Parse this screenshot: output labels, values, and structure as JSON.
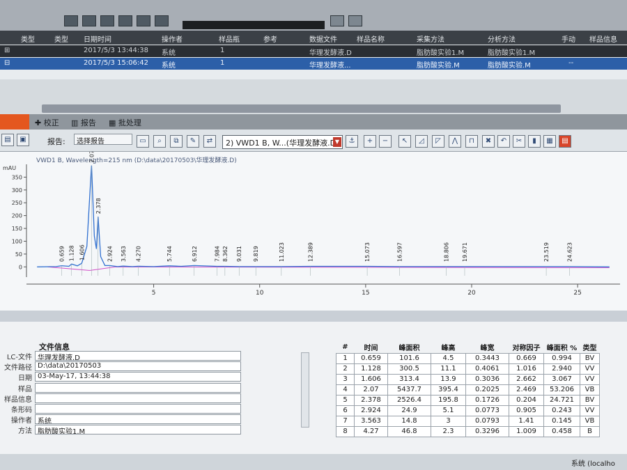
{
  "sequence_table": {
    "columns": [
      "类型",
      "类型",
      "日期时间",
      "操作者",
      "样品瓶",
      "参考",
      "数据文件",
      "样品名称",
      "采集方法",
      "分析方法",
      "手动",
      "样品信息"
    ],
    "rows": [
      {
        "datetime": "2017/5/3 13:44:38",
        "operator": "系统",
        "vial": "1",
        "data_file": "华理发酵液.D",
        "acq_method": "脂肪酸实验1.M",
        "ana_method": "脂肪酸实验1.M"
      },
      {
        "datetime": "2017/5/3 15:06:42",
        "operator": "系统",
        "vial": "1",
        "data_file": "华理发酵液...",
        "acq_method": "脂肪酸实验.M",
        "ana_method": "脂肪酸实验.M",
        "manual": "--"
      }
    ]
  },
  "tabs": [
    "校正",
    "报告",
    "批处理"
  ],
  "report_toolbar": {
    "label": "报告:",
    "report_name": "选择报告",
    "signal": "2) VWD1 B, W...",
    "signal_file": "(华理发酵液.D)"
  },
  "chromatogram": {
    "title": "VWD1 B, Wavelength=215 nm (D:\\data\\20170503\\华理发酵液.D)",
    "unit": "mAU"
  },
  "chart_data": {
    "type": "line",
    "title": "",
    "xlabel": "",
    "ylabel": "mAU",
    "xlim": [
      -1,
      27
    ],
    "ylim": [
      -40,
      400
    ],
    "x_ticks": [
      5,
      10,
      15,
      20,
      25
    ],
    "y_ticks": [
      0,
      50,
      100,
      150,
      200,
      250,
      300,
      350
    ],
    "grid": false,
    "series": [
      {
        "x": [
          -0.5,
          0.4,
          0.659,
          1.0,
          1.128,
          1.4,
          1.606,
          1.85,
          2.0,
          2.07,
          2.2,
          2.3,
          2.378,
          2.5,
          2.7,
          2.924,
          3.3,
          3.563,
          4.0,
          4.27,
          5.0,
          5.744,
          6.3,
          6.912,
          7.984,
          8.362,
          9.031,
          9.819,
          11.023,
          12.389,
          15.073,
          16.597,
          18.806,
          19.671,
          23.519,
          24.623,
          26.5
        ],
        "values": [
          0,
          1,
          4.5,
          2,
          11.1,
          4,
          13.9,
          80,
          300,
          395.4,
          120,
          70,
          195.8,
          40,
          5,
          5.1,
          1,
          3,
          1,
          2.3,
          1,
          4,
          2,
          5,
          2,
          2,
          1,
          1,
          1,
          2,
          2,
          1,
          1,
          1,
          1,
          1,
          0
        ]
      }
    ],
    "peak_labels": [
      "0.659",
      "1.128",
      "1.606",
      "2.070",
      "2.378",
      "2.924",
      "3.563",
      "4.270",
      "5.744",
      "6.912",
      "7.984",
      "8.362",
      "9.031",
      "9.819",
      "11.023",
      "12.389",
      "15.073",
      "16.597",
      "18.806",
      "19.671",
      "23.519",
      "24.623"
    ]
  },
  "file_info": {
    "header": "文件信息",
    "rows": [
      {
        "label": "LC-文件",
        "value": "华理发酵液.D"
      },
      {
        "label": "文件路径",
        "value": "D:\\data\\20170503"
      },
      {
        "label": "日期",
        "value": "03-May-17, 13:44:38"
      },
      {
        "label": "样品",
        "value": ""
      },
      {
        "label": "样品信息",
        "value": ""
      },
      {
        "label": "条形码",
        "value": ""
      },
      {
        "label": "操作者",
        "value": "系统"
      },
      {
        "label": "方法",
        "value": "脂肪酸实验1.M"
      }
    ]
  },
  "peak_table": {
    "headers": [
      "#",
      "时间",
      "峰面积",
      "峰高",
      "峰宽",
      "对称因子",
      "峰面积 %",
      "类型"
    ],
    "rows": [
      [
        "1",
        "0.659",
        "101.6",
        "4.5",
        "0.3443",
        "0.669",
        "0.994",
        "BV"
      ],
      [
        "2",
        "1.128",
        "300.5",
        "11.1",
        "0.4061",
        "1.016",
        "2.940",
        "VV"
      ],
      [
        "3",
        "1.606",
        "313.4",
        "13.9",
        "0.3036",
        "2.662",
        "3.067",
        "VV"
      ],
      [
        "4",
        "2.07",
        "5437.7",
        "395.4",
        "0.2025",
        "2.469",
        "53.206",
        "VB"
      ],
      [
        "5",
        "2.378",
        "2526.4",
        "195.8",
        "0.1726",
        "0.204",
        "24.721",
        "BV"
      ],
      [
        "6",
        "2.924",
        "24.9",
        "5.1",
        "0.0773",
        "0.905",
        "0.243",
        "VV"
      ],
      [
        "7",
        "3.563",
        "14.8",
        "3",
        "0.0793",
        "1.41",
        "0.145",
        "VB"
      ],
      [
        "8",
        "4.27",
        "46.8",
        "2.3",
        "0.3296",
        "1.009",
        "0.458",
        "B"
      ]
    ]
  },
  "status": {
    "text": "系统 (localho"
  },
  "colors": {
    "signal_line": "#2f6fd0",
    "baseline": "#d24cc8",
    "accent": "#e4571f"
  }
}
